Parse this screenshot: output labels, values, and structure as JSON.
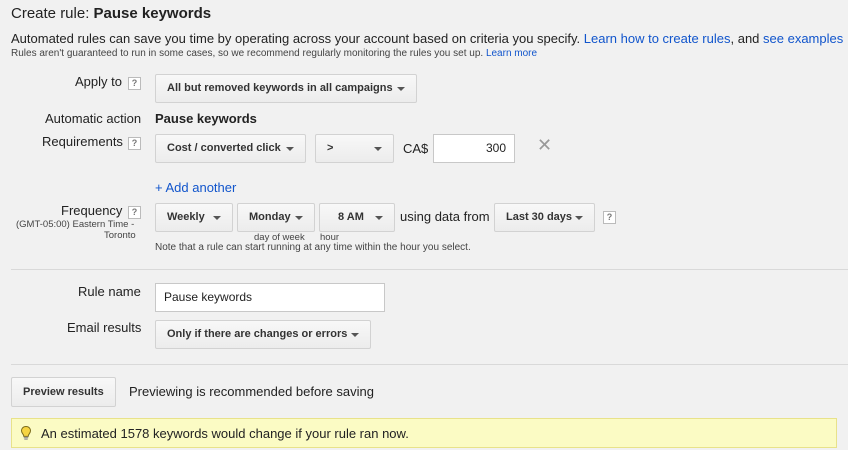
{
  "header": {
    "title_prefix": "Create rule: ",
    "title_bold": "Pause keywords"
  },
  "intro": {
    "text": "Automated rules can save you time by operating across your account based on criteria you specify. ",
    "learn_link": "Learn how to create rules",
    "and_text": ", and ",
    "examples_link": "see examples",
    "note": "Rules aren't guaranteed to run in some cases, so we recommend regularly monitoring the rules you set up. ",
    "note_link": "Learn more"
  },
  "apply_to": {
    "label": "Apply to",
    "help": "?",
    "value": "All but removed keywords in all campaigns"
  },
  "automatic_action": {
    "label": "Automatic action",
    "value": "Pause keywords"
  },
  "requirements": {
    "label": "Requirements",
    "help": "?",
    "metric": "Cost / converted click",
    "operator": ">",
    "currency": "CA$",
    "amount": "300",
    "remove": "✕",
    "add_another": "+ Add another"
  },
  "frequency": {
    "label": "Frequency",
    "help": "?",
    "timezone_line1": "(GMT-05:00) Eastern Time -",
    "timezone_line2": "Toronto",
    "period": "Weekly",
    "day": "Monday",
    "day_caption": "day of week",
    "hour": "8 AM",
    "hour_caption": "hour",
    "using_data_from": "using data from",
    "range": "Last 30 days",
    "range_help": "?",
    "note": "Note that a rule can start running at any time within the hour you select."
  },
  "rule_name": {
    "label": "Rule name",
    "value": "Pause keywords"
  },
  "email_results": {
    "label": "Email results",
    "value": "Only if there are changes or errors"
  },
  "preview": {
    "button": "Preview results",
    "text": "Previewing is recommended before saving"
  },
  "banner": {
    "icon": "lightbulb-icon",
    "text": "An estimated 1578 keywords would change if your rule ran now."
  }
}
